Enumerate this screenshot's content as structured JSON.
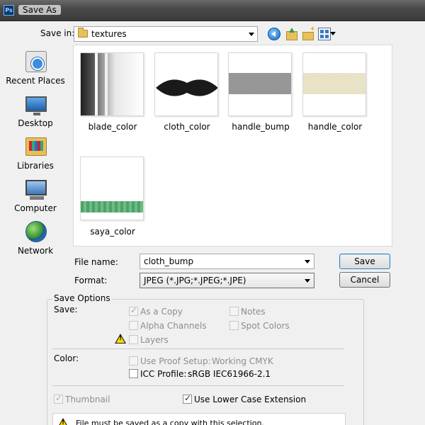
{
  "window": {
    "title": "Save As",
    "app_icon": "Ps"
  },
  "toolbar": {
    "save_in_label": "Save in:",
    "folder": "textures",
    "icons": [
      "back-icon",
      "up-folder-icon",
      "new-folder-icon",
      "views-menu-icon"
    ]
  },
  "places": [
    {
      "label": "Recent Places",
      "icon": "recent-places-icon"
    },
    {
      "label": "Desktop",
      "icon": "desktop-icon"
    },
    {
      "label": "Libraries",
      "icon": "libraries-icon"
    },
    {
      "label": "Computer",
      "icon": "computer-icon"
    },
    {
      "label": "Network",
      "icon": "network-icon"
    }
  ],
  "files": [
    {
      "name": "blade_color"
    },
    {
      "name": "cloth_color"
    },
    {
      "name": "handle_bump"
    },
    {
      "name": "handle_color"
    },
    {
      "name": "saya_color"
    }
  ],
  "form": {
    "file_name_label": "File name:",
    "file_name_value": "cloth_bump",
    "format_label": "Format:",
    "format_value": "JPEG (*.JPG;*.JPEG;*.JPE)",
    "save_button": "Save",
    "cancel_button": "Cancel"
  },
  "save_options": {
    "title": "Save Options",
    "save_label": "Save:",
    "as_a_copy": {
      "label": "As a Copy",
      "checked": true,
      "enabled": false
    },
    "notes": {
      "label": "Notes",
      "checked": false,
      "enabled": false
    },
    "alpha_channels": {
      "label": "Alpha Channels",
      "checked": false,
      "enabled": false
    },
    "spot_colors": {
      "label": "Spot Colors",
      "checked": false,
      "enabled": false
    },
    "layers": {
      "label": "Layers",
      "checked": false,
      "enabled": false
    },
    "color_label": "Color:",
    "use_proof_setup": {
      "label": "Use Proof Setup:",
      "value": "Working CMYK",
      "checked": false,
      "enabled": false
    },
    "icc_profile": {
      "label": "ICC Profile:",
      "value": "sRGB IEC61966-2.1",
      "checked": false,
      "enabled": true
    },
    "thumbnail": {
      "label": "Thumbnail",
      "checked": true,
      "enabled": false
    },
    "lower_case_ext": {
      "label": "Use Lower Case Extension",
      "checked": true,
      "enabled": true
    },
    "warning": "File must be saved as a copy with this selection."
  }
}
